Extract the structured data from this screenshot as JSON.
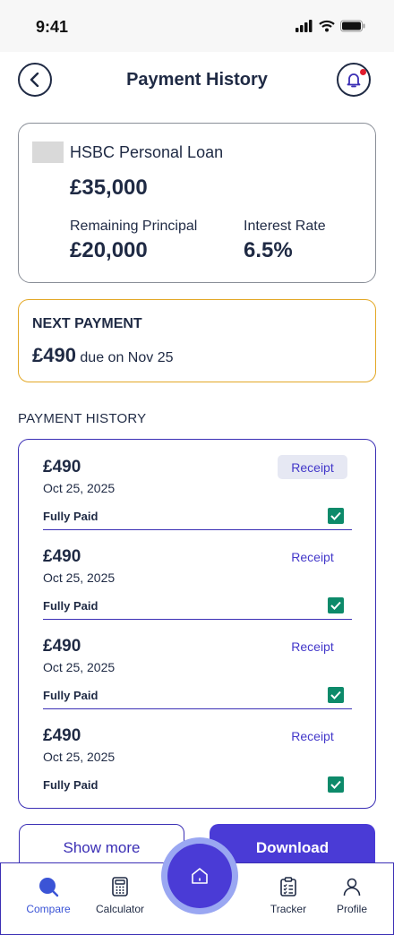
{
  "status": {
    "time": "9:41"
  },
  "header": {
    "title": "Payment History"
  },
  "loan": {
    "name": "HSBC Personal Loan",
    "amount": "£35,000",
    "remaining_label": "Remaining Principal",
    "remaining_value": "£20,000",
    "rate_label": "Interest Rate",
    "rate_value": "6.5%"
  },
  "next_payment": {
    "title": "NEXT PAYMENT",
    "amount": "£490",
    "due_text": "due on Nov 25"
  },
  "history": {
    "heading": "PAYMENT HISTORY",
    "items": [
      {
        "amount": "£490",
        "date": "Oct 25, 2025",
        "status": "Fully Paid",
        "receipt_label": "Receipt"
      },
      {
        "amount": "£490",
        "date": "Oct 25, 2025",
        "status": "Fully Paid",
        "receipt_label": "Receipt"
      },
      {
        "amount": "£490",
        "date": "Oct 25, 2025",
        "status": "Fully Paid",
        "receipt_label": "Receipt"
      },
      {
        "amount": "£490",
        "date": "Oct 25, 2025",
        "status": "Fully Paid",
        "receipt_label": "Receipt"
      }
    ]
  },
  "actions": {
    "show_more_label": "Show more",
    "download_label": "Download"
  },
  "nav": {
    "items": [
      {
        "label": "Compare",
        "icon": "compare-icon"
      },
      {
        "label": "Calculator",
        "icon": "calculator-icon"
      },
      {
        "label": "Tracker",
        "icon": "clipboard-icon"
      },
      {
        "label": "Profile",
        "icon": "user-icon"
      }
    ],
    "home_icon": "home-icon"
  },
  "colors": {
    "accent": "#4a3bd6",
    "highlight_border": "#e3a826",
    "paid_check": "#0d8a6a",
    "notification_dot": "#e11d2e"
  }
}
